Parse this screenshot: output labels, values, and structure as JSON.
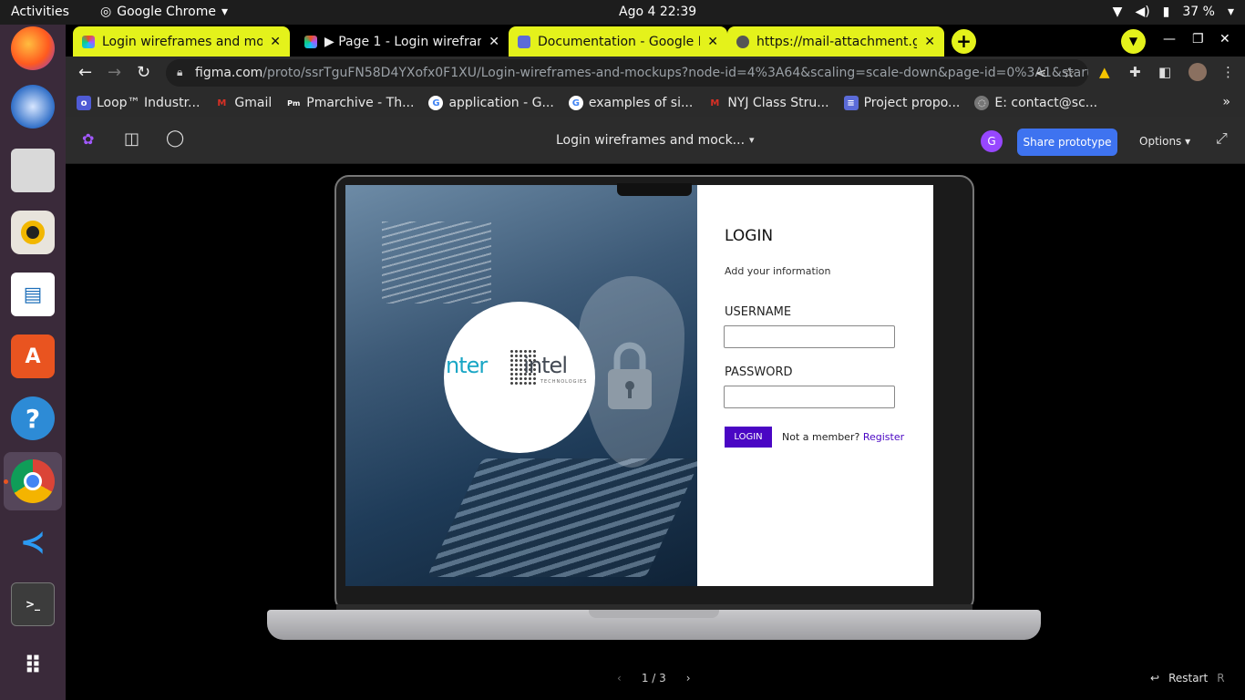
{
  "system": {
    "activities": "Activities",
    "app_name": "Google Chrome",
    "clock": "Ago 4  22:39",
    "battery": "37 %"
  },
  "tabs": [
    {
      "title": "Login wireframes and mo",
      "active": true
    },
    {
      "title": "▶ Page 1 - Login wirefram",
      "active": false
    },
    {
      "title": "Documentation - Google D",
      "active": true
    },
    {
      "title": "https://mail-attachment.g",
      "active": true
    }
  ],
  "address": {
    "host": "figma.com",
    "path": "/proto/ssrTguFN58D4YXofx0F1XU/Login-wireframes-and-mockups?node-id=4%3A64&scaling=scale-down&page-id=0%3A1&startin..."
  },
  "bookmarks": [
    {
      "label": "Loop™ Industr...",
      "icon": "loop-icon",
      "color": "#4f5bd5"
    },
    {
      "label": "Gmail",
      "icon": "gmail-icon",
      "color": "#d93025"
    },
    {
      "label": "Pmarchive - Th...",
      "icon": "pm-icon",
      "color": "#333333"
    },
    {
      "label": "application - G...",
      "icon": "google-icon",
      "color": "#4285f4"
    },
    {
      "label": "examples of si...",
      "icon": "google-icon",
      "color": "#4285f4"
    },
    {
      "label": "NYJ Class Stru...",
      "icon": "gmail-icon",
      "color": "#d93025"
    },
    {
      "label": "Project propo...",
      "icon": "docs-icon",
      "color": "#5b6bd8"
    },
    {
      "label": "E: contact@sc...",
      "icon": "globe-icon",
      "color": "#777777"
    }
  ],
  "figma": {
    "file_title": "Login wireframes and mock...",
    "avatar_letter": "G",
    "share_label": "Share prototype",
    "options_label": "Options"
  },
  "mockup": {
    "logo_left": "nter",
    "logo_right": "intel",
    "logo_sub": "TECHNOLOGIES",
    "heading": "LOGIN",
    "subheading": "Add your information",
    "username_label": "USERNAME",
    "password_label": "PASSWORD",
    "login_button": "LOGIN",
    "not_member": "Not a member?",
    "register": "Register"
  },
  "footer": {
    "page_indicator": "1 / 3",
    "restart_label": "Restart",
    "restart_key": "R"
  },
  "colors": {
    "chrome_tab_accent": "#e4f21b",
    "figma_share": "#3e73f0",
    "login_purple": "#4a06c4"
  }
}
